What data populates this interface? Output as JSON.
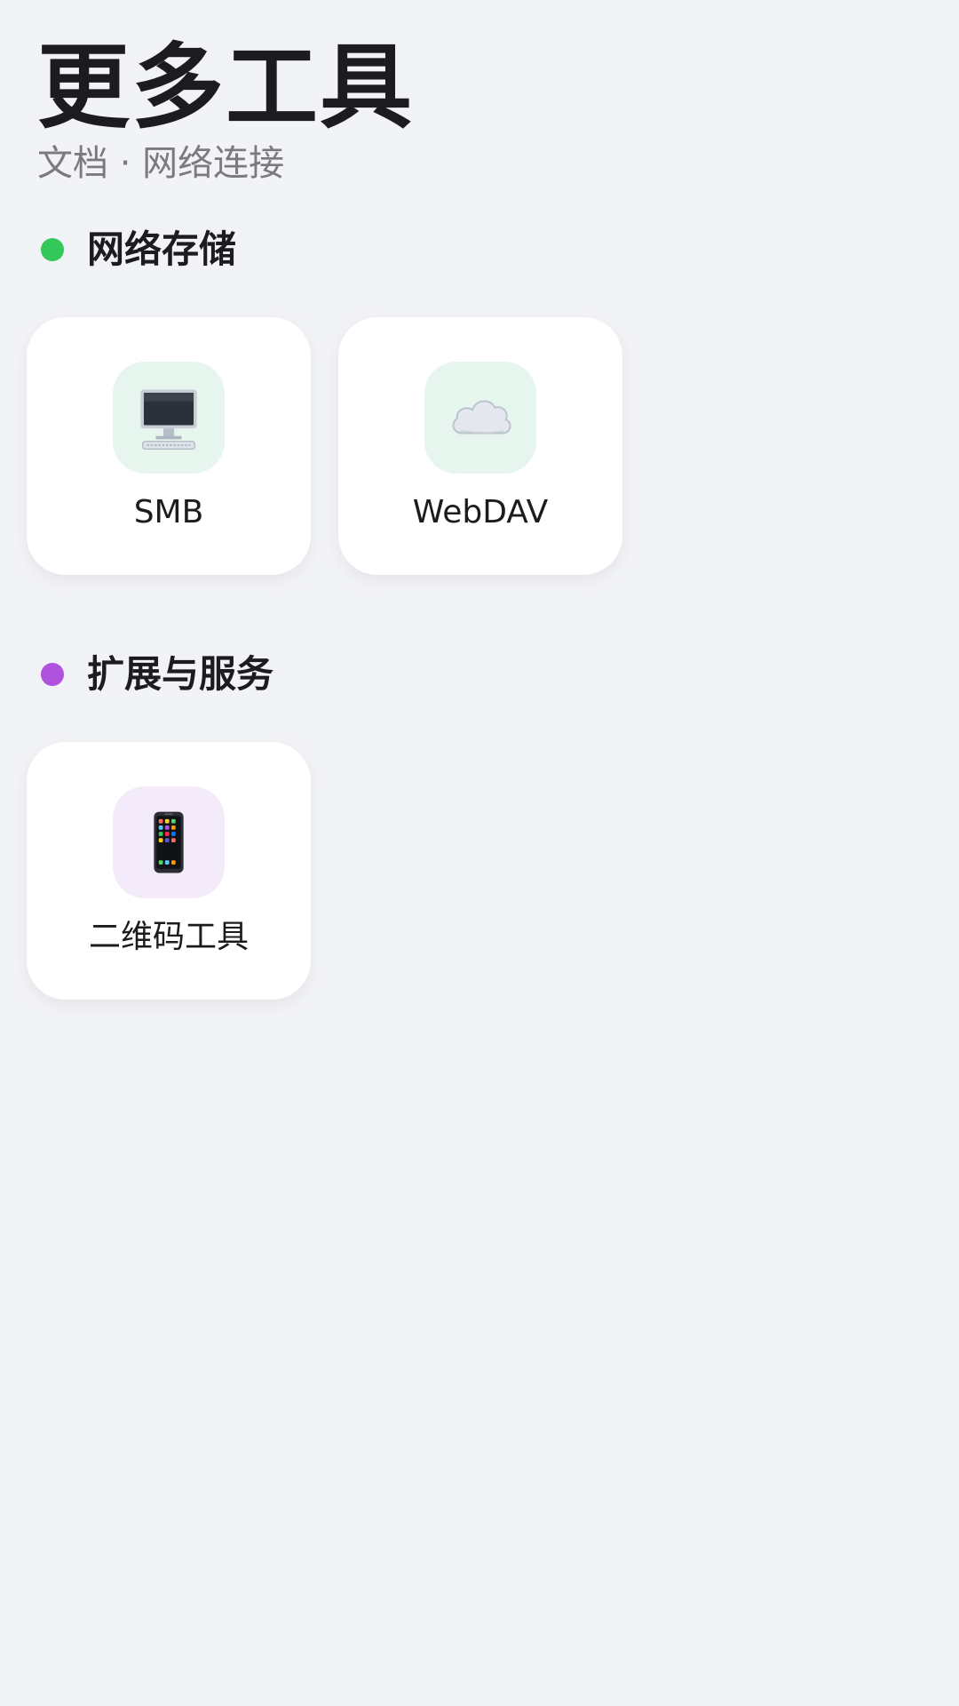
{
  "header": {
    "title": "更多工具",
    "subtitle": "文档 · 网络连接"
  },
  "sections": [
    {
      "title": "网络存储",
      "dot_color": "#34c759",
      "items": [
        {
          "label": "SMB",
          "icon": "desktop-computer-icon",
          "tile_color": "#e6f6ee"
        },
        {
          "label": "WebDAV",
          "icon": "cloud-icon",
          "tile_color": "#e6f6ee"
        }
      ]
    },
    {
      "title": "扩展与服务",
      "dot_color": "#af52de",
      "items": [
        {
          "label": "二维码工具",
          "icon": "smartphone-icon",
          "tile_color": "#f3ebf9"
        }
      ]
    }
  ]
}
